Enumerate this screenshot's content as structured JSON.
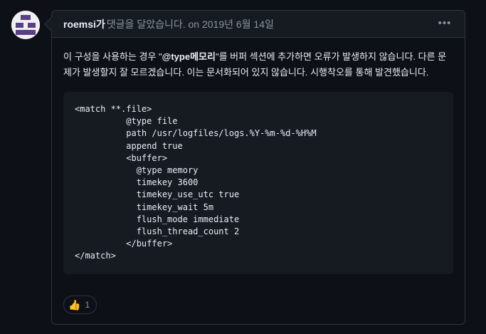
{
  "comment": {
    "author": "roemsi가",
    "action_text": "댓글을 달았습니다. on 2019년 6월 14일",
    "more_icon": "kebab-horizontal-icon",
    "body": {
      "part1": "이 구성을 사용하는 경우 \"",
      "bold": "@type메모리",
      "part2": "\"를 버퍼 섹션에 추가하면 오류가 발생하지 않습니다. 다른 문제가 발생할지 잘 모르겠습니다. 이는 문서화되어 있지 않습니다. 시행착오를 통해 발견했습니다."
    },
    "code": [
      "<match **.file>",
      "          @type file",
      "          path /usr/logfiles/logs.%Y-%m-%d-%H%M",
      "          append true",
      "          <buffer>",
      "            @type memory",
      "            timekey 3600",
      "            timekey_use_utc true",
      "            timekey_wait 5m",
      "            flush_mode immediate",
      "            flush_thread_count 2",
      "          </buffer>",
      "</match>"
    ],
    "reaction": {
      "emoji": "👍",
      "icon": "thumbs-up-icon",
      "count": "1"
    }
  },
  "colors": {
    "background": "#0d1117",
    "header_bg": "#161b22",
    "border": "#30363d",
    "muted_text": "#8b949e",
    "avatar_identicon": "#5a3f87"
  }
}
